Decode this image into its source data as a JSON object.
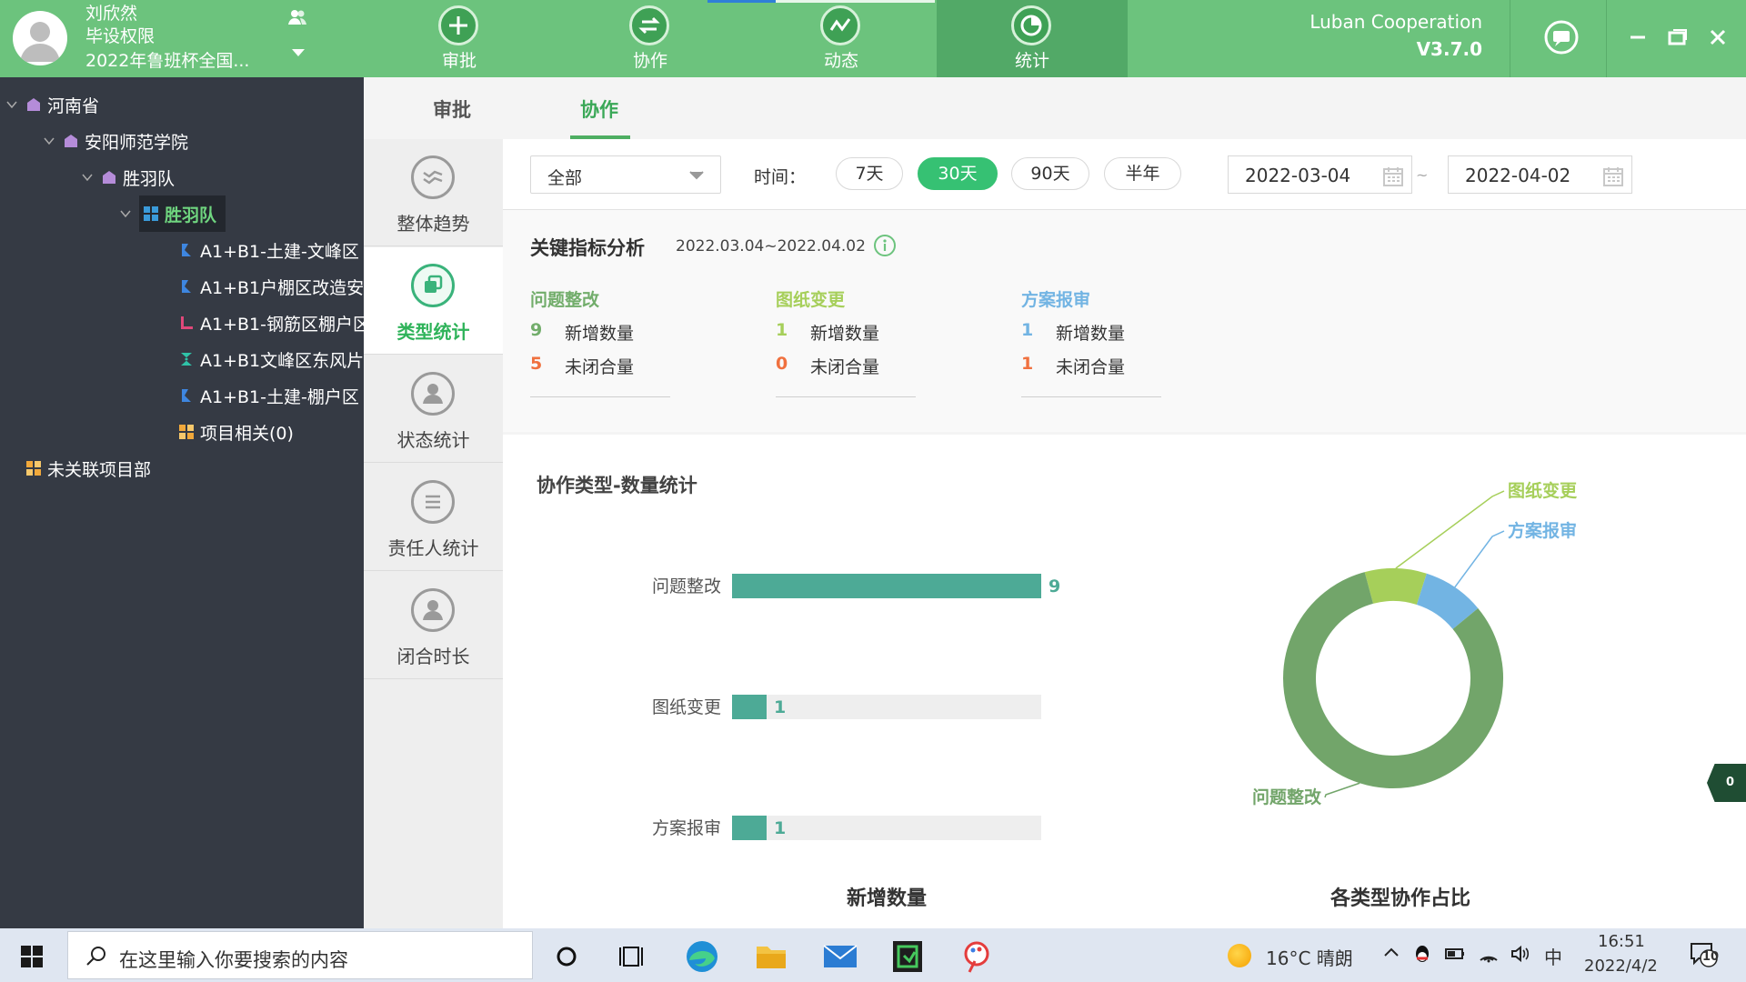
{
  "user": {
    "name": "刘欣然",
    "role": "毕设权限",
    "project": "2022年鲁班杯全国..."
  },
  "nav": {
    "items": [
      "审批",
      "协作",
      "动态",
      "统计"
    ],
    "active_index": 3
  },
  "brand": {
    "name": "Luban Cooperation",
    "version": "V3.7.0"
  },
  "tree": {
    "province": "河南省",
    "school": "安阳师范学院",
    "team": "胜羽队",
    "team_selected": "胜羽队",
    "projects": [
      "A1+B1-土建-文峰区",
      "A1+B1户棚区改造安",
      "A1+B1-钢筋区棚户区",
      "A1+B1文峰区东风片",
      "A1+B1-土建-棚户区"
    ],
    "project_related": "项目相关(0)",
    "unlinked": "未关联项目部"
  },
  "tabs": [
    "审批",
    "协作"
  ],
  "subnav": [
    "整体趋势",
    "类型统计",
    "状态统计",
    "责任人统计",
    "闭合时长"
  ],
  "filter": {
    "scope": "全部",
    "time_label": "时间：",
    "ranges": [
      "7天",
      "30天",
      "90天",
      "半年"
    ],
    "active_range": "30天",
    "start_date": "2022-03-04",
    "separator": "~",
    "end_date": "2022-04-02"
  },
  "kpi": {
    "title": "关键指标分析",
    "range": "2022.03.04~2022.04.02",
    "groups": [
      {
        "title": "问题整改",
        "color": "#72ad6b",
        "num_color": "#72ad6b",
        "new_label": "新增数量",
        "new": "9",
        "open_label": "未闭合量",
        "open": "5"
      },
      {
        "title": "图纸变更",
        "color": "#a6cf5a",
        "num_color": "#a6cf5a",
        "new_label": "新增数量",
        "new": "1",
        "open_label": "未闭合量",
        "open": "0"
      },
      {
        "title": "方案报审",
        "color": "#72b4e3",
        "num_color": "#72b4e3",
        "new_label": "新增数量",
        "new": "1",
        "open_label": "未闭合量",
        "open": "1"
      }
    ],
    "open_color": "#f0713f"
  },
  "charts": {
    "heading": "协作类型-数量统计",
    "bar_caption": "新增数量",
    "donut_caption": "各类型协作占比"
  },
  "chart_data": [
    {
      "type": "bar",
      "orientation": "horizontal",
      "categories": [
        "问题整改",
        "图纸变更",
        "方案报审"
      ],
      "values": [
        9,
        1,
        1
      ],
      "xlim": [
        0,
        9
      ],
      "color": "#4daa96",
      "track_color": "#eeeeee",
      "title": "新增数量"
    },
    {
      "type": "pie",
      "style": "donut",
      "labels": [
        "问题整改",
        "图纸变更",
        "方案报审"
      ],
      "values": [
        9,
        1,
        1
      ],
      "colors": [
        "#72a56a",
        "#a6cf5a",
        "#72b4e3"
      ],
      "title": "各类型协作占比"
    }
  ],
  "side_badge": "0",
  "taskbar": {
    "search_placeholder": "在这里输入你要搜索的内容",
    "weather": "16°C  晴朗",
    "ime": "中",
    "time": "16:51",
    "date": "2022/4/2",
    "notifications": "10"
  }
}
